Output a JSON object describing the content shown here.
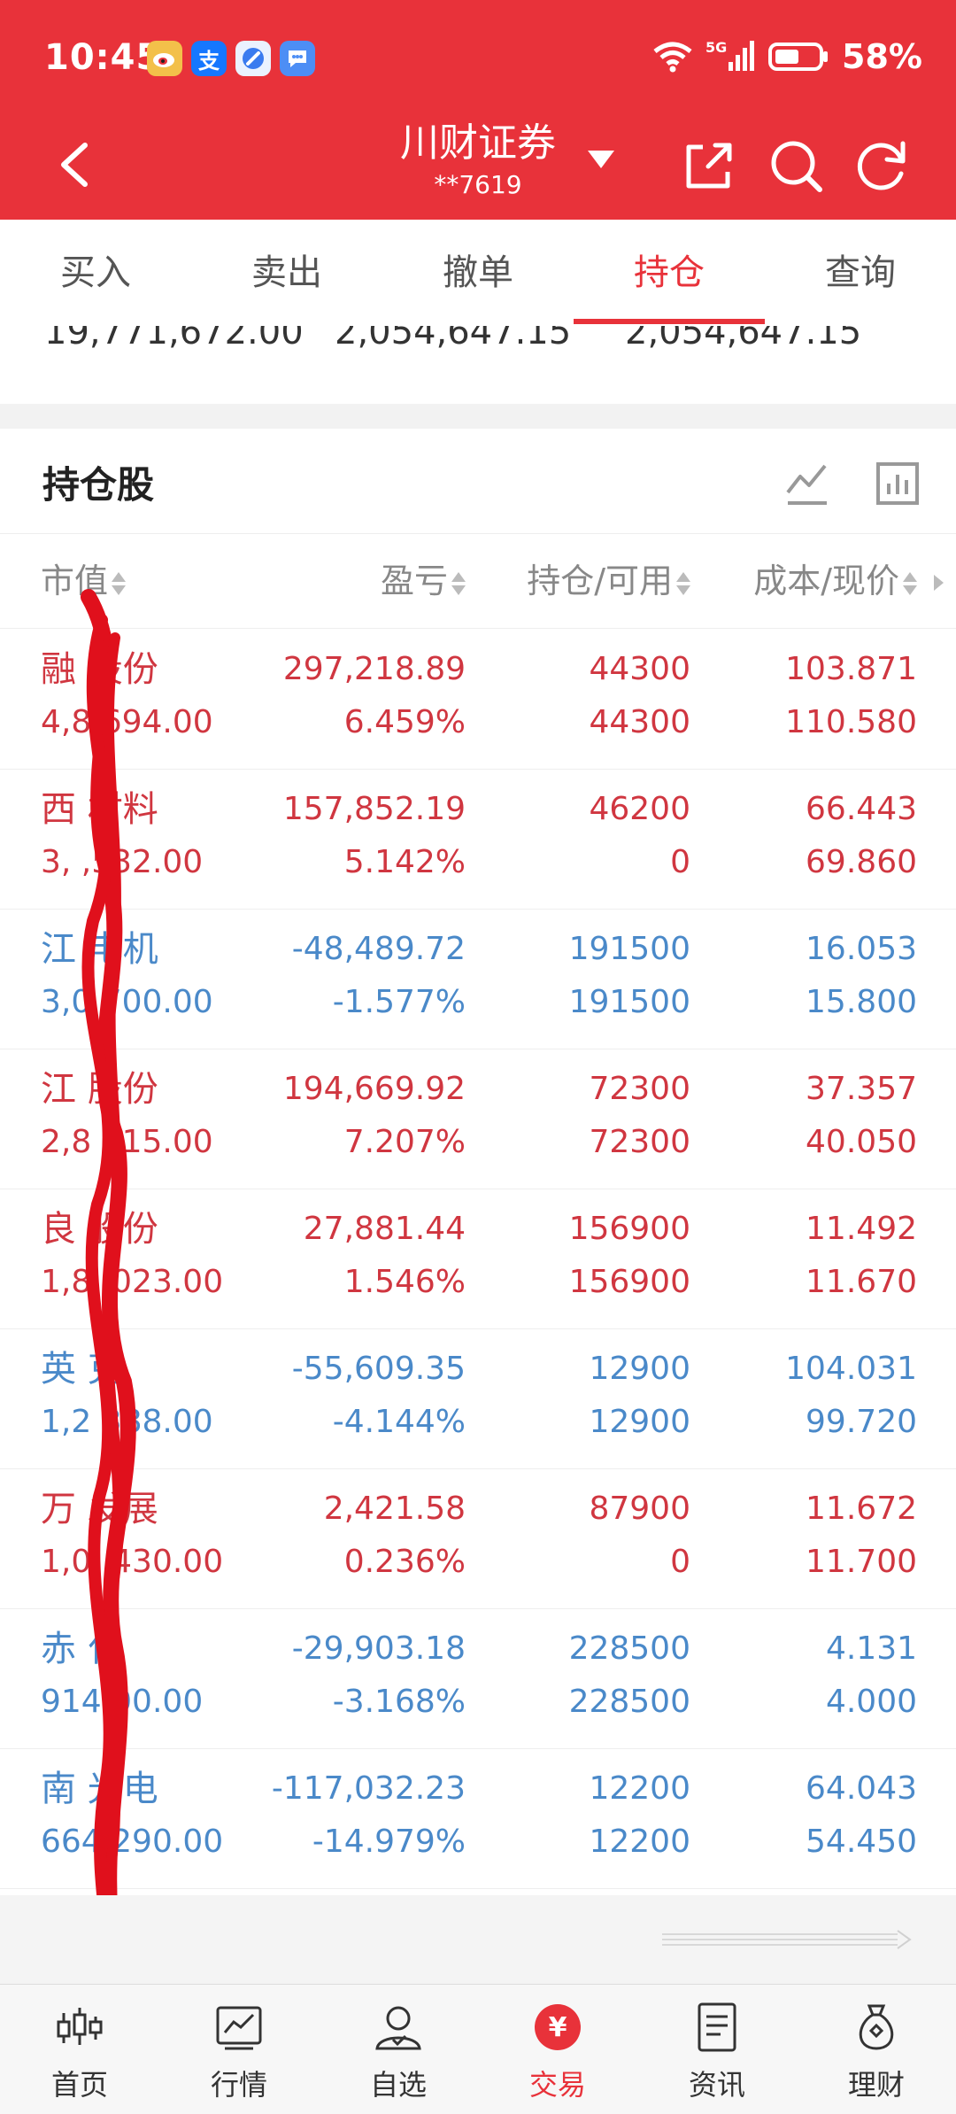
{
  "status_bar": {
    "time": "10:45",
    "battery": "58%",
    "network": "5G",
    "app_icons": [
      "weibo-icon",
      "alipay-icon",
      "browser-icon",
      "message-icon"
    ],
    "alipay_glyph": "支"
  },
  "navbar": {
    "title": "川财证券",
    "account": "**7619"
  },
  "tabs": [
    {
      "label": "买入",
      "active": false
    },
    {
      "label": "卖出",
      "active": false
    },
    {
      "label": "撤单",
      "active": false
    },
    {
      "label": "持仓",
      "active": true
    },
    {
      "label": "查询",
      "active": false
    }
  ],
  "summary": {
    "values": [
      "19,771,672.00",
      "2,054,647.15",
      "2,054,647.15"
    ]
  },
  "holdings": {
    "title": "持仓股",
    "columns": [
      "市值",
      "盈亏",
      "持仓/可用",
      "成本/现价"
    ],
    "rows": [
      {
        "name": "融 股份",
        "market_value": "4,8 694.00",
        "pnl": "297,218.89",
        "pnl_pct": "6.459%",
        "position": "44300",
        "available": "44300",
        "cost": "103.871",
        "price": "110.580",
        "color": "red"
      },
      {
        "name": "西 材料",
        "market_value": "3, ,532.00",
        "pnl": "157,852.19",
        "pnl_pct": "5.142%",
        "position": "46200",
        "available": "0",
        "cost": "66.443",
        "price": "69.860",
        "color": "red"
      },
      {
        "name": "江 电机",
        "market_value": "3,0 700.00",
        "pnl": "-48,489.72",
        "pnl_pct": "-1.577%",
        "position": "191500",
        "available": "191500",
        "cost": "16.053",
        "price": "15.800",
        "color": "blue"
      },
      {
        "name": "江 股份",
        "market_value": "2,8 615.00",
        "pnl": "194,669.92",
        "pnl_pct": "7.207%",
        "position": "72300",
        "available": "72300",
        "cost": "37.357",
        "price": "40.050",
        "color": "red"
      },
      {
        "name": "良 股份",
        "market_value": "1,8 ,023.00",
        "pnl": "27,881.44",
        "pnl_pct": "1.546%",
        "position": "156900",
        "available": "156900",
        "cost": "11.492",
        "price": "11.670",
        "color": "red"
      },
      {
        "name": "英 克",
        "market_value": "1,2 388.00",
        "pnl": "-55,609.35",
        "pnl_pct": "-4.144%",
        "position": "12900",
        "available": "12900",
        "cost": "104.031",
        "price": "99.720",
        "color": "blue"
      },
      {
        "name": "万 发展",
        "market_value": "1,0 ,430.00",
        "pnl": "2,421.58",
        "pnl_pct": "0.236%",
        "position": "87900",
        "available": "0",
        "cost": "11.672",
        "price": "11.700",
        "color": "red"
      },
      {
        "name": "赤 化",
        "market_value": "914 00.00",
        "pnl": "-29,903.18",
        "pnl_pct": "-3.168%",
        "position": "228500",
        "available": "228500",
        "cost": "4.131",
        "price": "4.000",
        "color": "blue"
      },
      {
        "name": "南 光电",
        "market_value": "664 290.00",
        "pnl": "-117,032.23",
        "pnl_pct": "-14.979%",
        "position": "12200",
        "available": "12200",
        "cost": "64.043",
        "price": "54.450",
        "color": "blue"
      }
    ]
  },
  "colors": {
    "accent": "#e8323a",
    "gain": "#d03640",
    "loss": "#4a89c9"
  },
  "bottom_nav": [
    {
      "label": "首页",
      "icon": "candlestick-icon",
      "active": false
    },
    {
      "label": "行情",
      "icon": "chart-icon",
      "active": false
    },
    {
      "label": "自选",
      "icon": "person-icon",
      "active": false
    },
    {
      "label": "交易",
      "icon": "yuan-icon",
      "active": true,
      "glyph": "¥"
    },
    {
      "label": "资讯",
      "icon": "document-icon",
      "active": false
    },
    {
      "label": "理财",
      "icon": "moneybag-icon",
      "active": false
    }
  ]
}
